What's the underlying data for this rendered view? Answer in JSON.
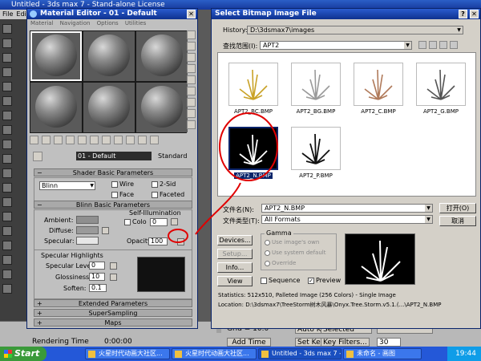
{
  "app": {
    "title": "Untitled - 3ds max 7 - Stand-alone License",
    "menu": [
      "File",
      "Edit"
    ]
  },
  "material_editor": {
    "title": "Material Editor - 01 - Default",
    "menu": [
      "Material",
      "Navigation",
      "Options",
      "Utilities"
    ],
    "material_name": "01 - Default",
    "material_type": "Standard",
    "rollouts": {
      "shader_basic": "Shader Basic Parameters",
      "blinn_basic": "Blinn Basic Parameters",
      "specular_highlights": "Specular Highlights",
      "extended": "Extended Parameters",
      "supersampling": "SuperSampling",
      "maps": "Maps"
    },
    "shader": "Blinn",
    "options": {
      "wire": "Wire",
      "two_sided": "2-Sid",
      "face_map": "Face",
      "faceted": "Faceted"
    },
    "labels": {
      "ambient": "Ambient:",
      "diffuse": "Diffuse:",
      "specular": "Specular:",
      "self_illum": "Self-Illumination",
      "color": "Colo",
      "opacity": "Opacity:",
      "specular_level": "Specular Level:",
      "glossiness": "Glossiness:",
      "soften": "Soften:"
    },
    "values": {
      "self_illum_color": "0",
      "opacity": "100",
      "specular_level": "0",
      "glossiness": "10",
      "soften": "0.1"
    },
    "colors": {
      "ambient": "#8f8f8f",
      "diffuse": "#9a9a9a",
      "specular": "#e6e6e6"
    }
  },
  "dialog": {
    "title": "Select Bitmap Image File",
    "history_label": "History:",
    "history_value": "D:\\3dsmax7\\images",
    "look_in_label": "查找范围(I):",
    "look_in_value": "APT2",
    "files": [
      {
        "name": "APT2_BC.BMP",
        "tint": "#c9a227"
      },
      {
        "name": "APT2_BG.BMP",
        "tint": "#9a9a9a"
      },
      {
        "name": "APT2_C.BMP",
        "tint": "#b07a5a"
      },
      {
        "name": "APT2_G.BMP",
        "tint": "#555555"
      },
      {
        "name": "APT2_N.BMP",
        "tint": "#ffffff"
      },
      {
        "name": "APT2_P.BMP",
        "tint": "#111111"
      }
    ],
    "filename_label": "文件名(N):",
    "filename_value": "APT2_N.BMP",
    "filetype_label": "文件类型(T):",
    "filetype_value": "All Formats",
    "open_button": "打开(O)",
    "cancel_button": "取消",
    "devices_button": "Devices...",
    "setup_button": "Setup...",
    "info_button": "Info...",
    "view_button": "View",
    "gamma_title": "Gamma",
    "gamma_options": [
      "Use image's own",
      "Use system default",
      "Override"
    ],
    "sequence_label": "Sequence",
    "preview_label": "Preview",
    "statistics": "Statistics:  512x510, Palleted Image (256 Colors) - Single Image",
    "location": "Location:  D:\\3dsmax7\\TreeStorm树木风暴\\Onyx.Tree.Storm.v5.1.(...\\APT2_N.BMP"
  },
  "status": {
    "grid": "Grid = 10.0",
    "add_time_tag": "Add Time Tag",
    "rendering_time": "Rendering Time",
    "rendering_value": "0:00:00",
    "auto_key": "Auto Key",
    "selected": "Selected",
    "set_key": "Set Key",
    "key_filters": "Key Filters...",
    "frame": "30"
  },
  "taskbar": {
    "start": "Start",
    "tasks": [
      "火星时代动画大社区...",
      "火星时代动画大社区...",
      "Untitled - 3ds max 7 -...",
      "未命名 - 画图"
    ],
    "clock": "19:44"
  }
}
